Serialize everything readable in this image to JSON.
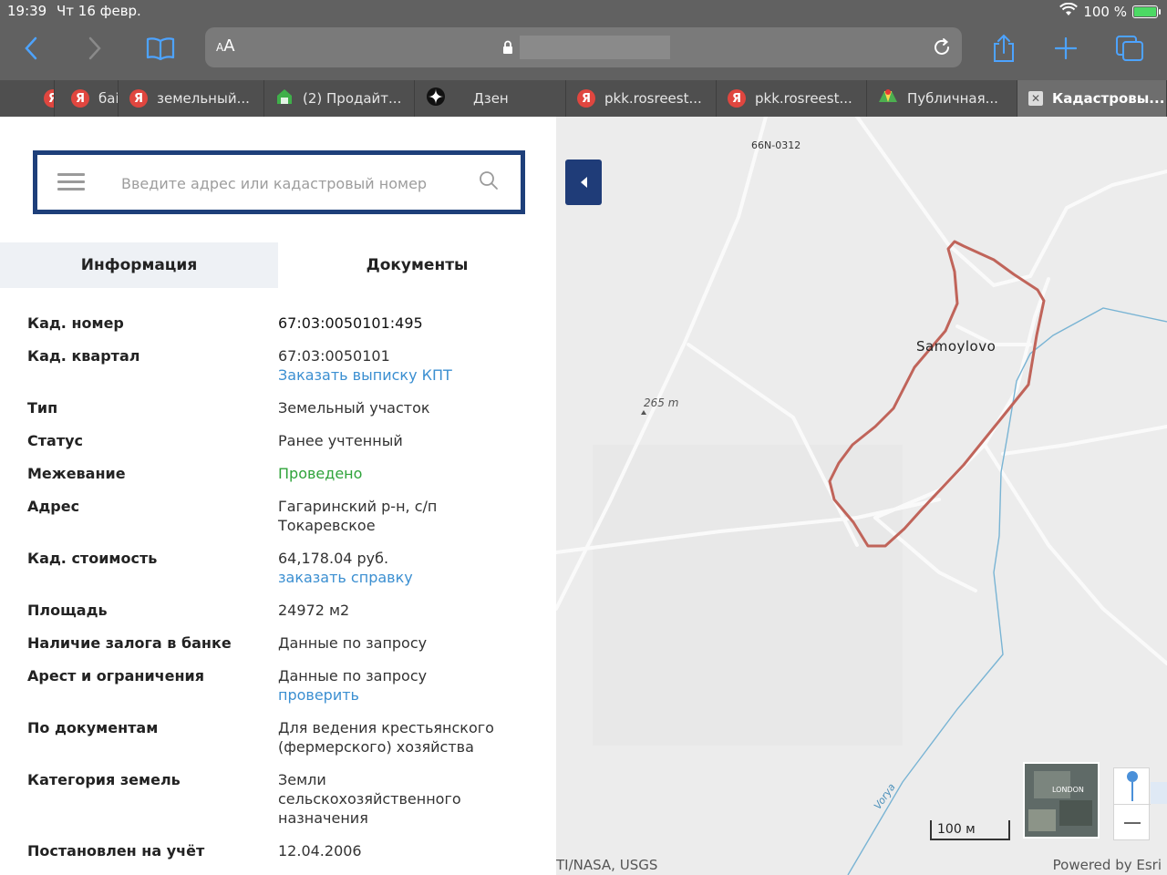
{
  "status": {
    "time": "19:39",
    "date": "Чт 16 февр.",
    "battery": "100 %",
    "battery_level": 1.0
  },
  "browser": {
    "reader_label_small": "A",
    "reader_label_big": "A",
    "tabs": [
      {
        "label": "",
        "icon": "yandex-icon",
        "active": false
      },
      {
        "label": "баі",
        "icon": "yandex-icon",
        "active": false
      },
      {
        "label": "земельный...",
        "icon": "yandex-icon",
        "active": false
      },
      {
        "label": "(2) Продайт...",
        "icon": "house-icon",
        "active": false
      },
      {
        "label": "Дзен",
        "icon": "zen-icon",
        "active": false
      },
      {
        "label": "pkk.rosreest...",
        "icon": "yandex-icon",
        "active": false
      },
      {
        "label": "pkk.rosreest...",
        "icon": "yandex-icon",
        "active": false
      },
      {
        "label": "Публичная...",
        "icon": "maps-icon",
        "active": false
      },
      {
        "label": "Кадастровы...",
        "icon": "close-icon",
        "active": true
      }
    ],
    "yandex_letter": "Я"
  },
  "search": {
    "placeholder": "Введите адрес или кадастровый номер"
  },
  "info_tabs": {
    "info": "Информация",
    "docs": "Документы"
  },
  "details": {
    "cad_number": {
      "label": "Кад. номер",
      "value": "67:03:0050101:495"
    },
    "cad_quarter": {
      "label": "Кад. квартал",
      "value": "67:03:0050101",
      "link": "Заказать выписку КПТ"
    },
    "type": {
      "label": "Тип",
      "value": "Земельный участок"
    },
    "status": {
      "label": "Статус",
      "value": "Ранее учтенный"
    },
    "survey": {
      "label": "Межевание",
      "value": "Проведено"
    },
    "address": {
      "label": "Адрес",
      "value_line1": "Гагаринский р-н, с/п",
      "value_line2": "Токаревское"
    },
    "cad_cost": {
      "label": "Кад. стоимость",
      "value": "64,178.04 руб.",
      "link": "заказать справку"
    },
    "area": {
      "label": "Площадь",
      "value": "24972 м2"
    },
    "pledge": {
      "label": "Наличие залога в банке",
      "value": "Данные по запросу"
    },
    "arrest": {
      "label": "Арест и ограничения",
      "value": "Данные по запросу",
      "link": "проверить"
    },
    "by_docs": {
      "label": "По документам",
      "value_line1": "Для ведения крестьянского",
      "value_line2": "(фермерского) хозяйства"
    },
    "land_category": {
      "label": "Категория земель",
      "value_line1": "Земли",
      "value_line2": "сельскохозяйственного",
      "value_line3": "назначения"
    },
    "registered": {
      "label": "Постановлен на учёт",
      "value": "12.04.2006"
    }
  },
  "map": {
    "road_label": "66N-0312",
    "town_label": "Samoylovo",
    "elevation_label": "265 m",
    "river_label": "Vorya",
    "scale_label": "100 м",
    "minimap_label": "LONDON",
    "attribution_left": "TI/NASA, USGS",
    "attribution_right": "Powered by Esri",
    "parcel_color": "#c0645a",
    "river_color": "#79b4d4"
  }
}
